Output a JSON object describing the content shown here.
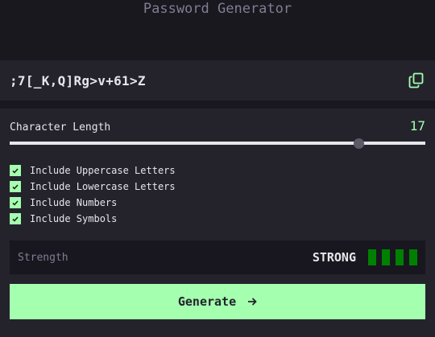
{
  "app": {
    "title": "Password Generator"
  },
  "password": {
    "value": ";7[_K,Q]Rg>v+61>Z",
    "copy_icon": "copy-icon"
  },
  "length": {
    "label": "Character Length",
    "value": "17",
    "slider_fraction": 0.84
  },
  "options": [
    {
      "label": "Include Uppercase Letters",
      "checked": true
    },
    {
      "label": "Include Lowercase Letters",
      "checked": true
    },
    {
      "label": "Include Numbers",
      "checked": true
    },
    {
      "label": "Include Symbols",
      "checked": true
    }
  ],
  "strength": {
    "label": "Strength",
    "value": "STRONG",
    "bars_filled": 4,
    "bars_total": 4
  },
  "generate": {
    "label": "Generate",
    "icon": "arrow-right-icon"
  },
  "colors": {
    "accent": "#a4ffaf",
    "background": "#19181f",
    "panel": "#24232c",
    "muted_text": "#817d92",
    "strength_bar": "#008000"
  }
}
